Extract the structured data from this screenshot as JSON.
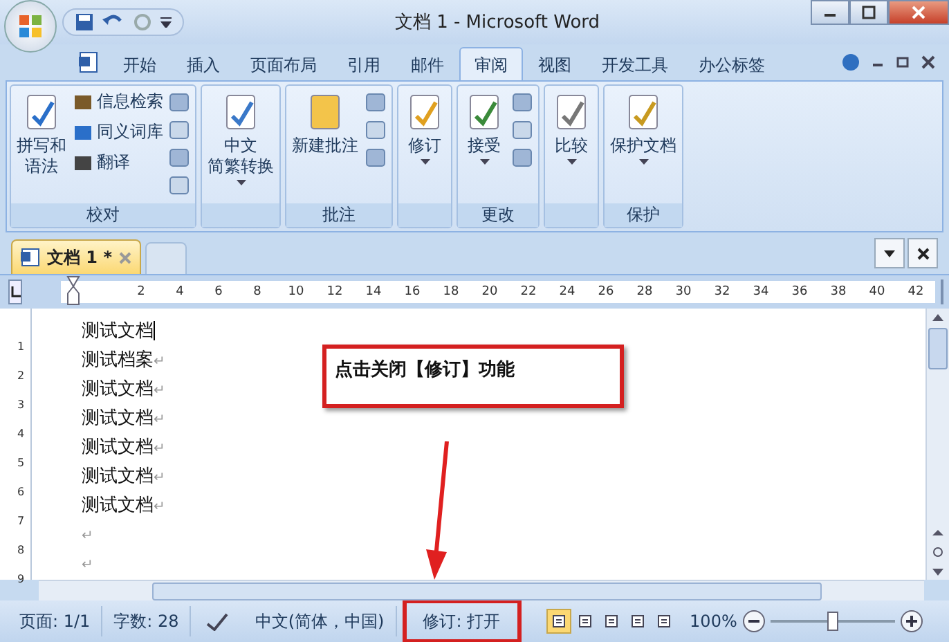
{
  "window": {
    "title": "文档 1 - Microsoft Word"
  },
  "ribbon_tabs": [
    {
      "label": "开始",
      "selected": false
    },
    {
      "label": "插入",
      "selected": false
    },
    {
      "label": "页面布局",
      "selected": false
    },
    {
      "label": "引用",
      "selected": false
    },
    {
      "label": "邮件",
      "selected": false
    },
    {
      "label": "审阅",
      "selected": true
    },
    {
      "label": "视图",
      "selected": false
    },
    {
      "label": "开发工具",
      "selected": false
    },
    {
      "label": "办公标签",
      "selected": false
    }
  ],
  "groups": [
    {
      "label": "校对",
      "large": [
        {
          "lines": [
            "拼写和",
            "语法"
          ],
          "caret": false
        }
      ],
      "small": [
        {
          "label": "信息检索"
        },
        {
          "label": "同义词库"
        },
        {
          "label": "翻译"
        }
      ]
    },
    {
      "large": [
        {
          "lines": [
            "中文",
            "简繁转换"
          ],
          "caret": true
        }
      ]
    },
    {
      "label": "批注",
      "large": [
        {
          "lines": [
            "新建批注"
          ],
          "caret": false
        }
      ]
    },
    {
      "large": [
        {
          "lines": [
            "修订"
          ],
          "caret": true
        }
      ]
    },
    {
      "label": "更改",
      "large": [
        {
          "lines": [
            "接受"
          ],
          "caret": true
        }
      ]
    },
    {
      "large": [
        {
          "lines": [
            "比较"
          ],
          "caret": true
        }
      ]
    },
    {
      "label": "保护",
      "large": [
        {
          "lines": [
            "保护文档"
          ],
          "caret": true
        }
      ]
    }
  ],
  "doc_tab": {
    "label": "文档 1 *"
  },
  "ruler": [
    "2",
    "4",
    "6",
    "8",
    "10",
    "12",
    "14",
    "16",
    "18",
    "20",
    "22",
    "24",
    "26",
    "28",
    "30",
    "32",
    "34",
    "36",
    "38",
    "40",
    "42"
  ],
  "vertical_ruler": [
    "1",
    "2",
    "3",
    "4",
    "5",
    "6",
    "7",
    "8",
    "9"
  ],
  "lines": [
    {
      "text": "测试文档",
      "cursor": true
    },
    {
      "text": "测试档案",
      "mark": "↵"
    },
    {
      "text": "测试文档",
      "mark": "↵"
    },
    {
      "text": "测试文档",
      "mark": "↵"
    },
    {
      "text": "测试文档",
      "mark": "↵"
    },
    {
      "text": "测试文档",
      "mark": "↵"
    },
    {
      "text": "测试文档",
      "mark": "↵"
    },
    {
      "mark": "↵"
    },
    {
      "mark": "↵"
    }
  ],
  "annotation": {
    "text": "点击关闭【修订】功能"
  },
  "status_bar": {
    "page": "页面: 1/1",
    "words": "字数: 28",
    "language": "中文(简体，中国)",
    "track_changes": "修订: 打开",
    "zoom": "100%",
    "zoom_level": {
      "level": 0.5
    },
    "views": [
      {
        "selected": true
      },
      {
        "selected": false
      },
      {
        "selected": false
      },
      {
        "selected": false
      },
      {
        "selected": false
      }
    ]
  }
}
